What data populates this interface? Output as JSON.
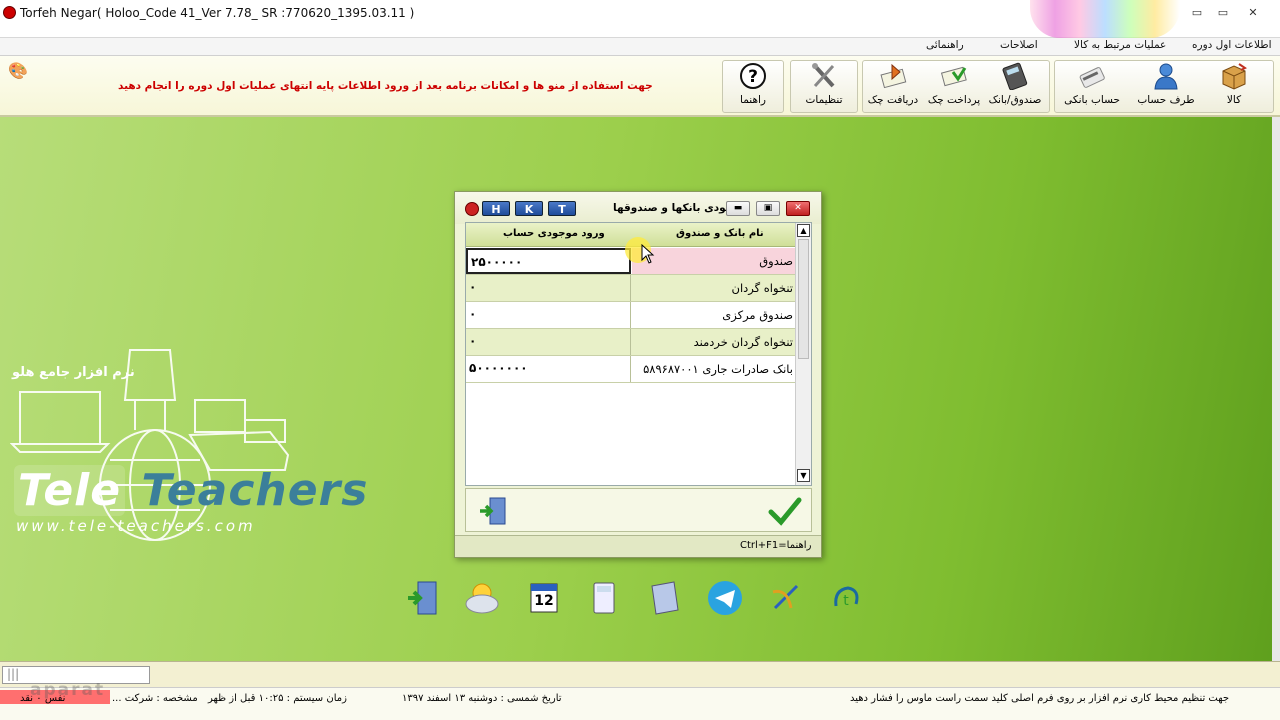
{
  "window": {
    "title": "Torfeh Negar( Holoo_Code 41_Ver 7.78_ SR :770620_1395.03.11 )",
    "controls": [
      "▭",
      "▭",
      "✕"
    ]
  },
  "menubar": {
    "items": [
      "اطلاعات اول دوره",
      "عملیات مرتبط به کالا",
      "اصلاحات",
      "راهنمائی"
    ]
  },
  "toolbar": {
    "notice": "جهت استفاده از منو ها و امکانات برنامه بعد از ورود اطلاعات پایه انتهای عملیات اول دوره را انجام دهید",
    "buttons": [
      "کالا",
      "طرف حساب",
      "حساب بانکی",
      "صندوق/بانک",
      "پرداخت چک",
      "دریافت چک",
      "تنظیمات",
      "راهنما"
    ],
    "icons": [
      "box-icon",
      "person-icon",
      "bank-card-icon",
      "calculator-icon",
      "pay-check-icon",
      "receive-check-icon",
      "tools-icon",
      "help-icon"
    ]
  },
  "desktop": {
    "brand_text": "نرم افزار جامع هلو",
    "tele_part1": "Tele",
    "tele_part2": "Teachers",
    "tele_url": "www.tele-teachers.com",
    "dock_icons": [
      "exit-door-icon",
      "weather-icon",
      "calendar-icon",
      "calculator-icon",
      "notes-icon",
      "telegram-icon",
      "satellite-icon",
      "logo-icon"
    ],
    "calendar_day": "12"
  },
  "dialog": {
    "title": "موجودی بانکها و صندوقها",
    "hkt_buttons": [
      "H",
      "K",
      "T"
    ],
    "columns": [
      "نام بانک و صندوق",
      "ورود موجودی حساب"
    ],
    "rows": [
      {
        "name": "صندوق",
        "amount": "۲۵۰۰۰۰۰"
      },
      {
        "name": "تنخواه گردان",
        "amount": "۰"
      },
      {
        "name": "صندوق مرکزی",
        "amount": "۰"
      },
      {
        "name": "تنخواه گردان خردمند",
        "amount": "۰"
      },
      {
        "name": "بانک صادرات جاری ۵۸۹۶۸۷۰۰۱",
        "amount": "۵۰۰۰۰۰۰۰"
      }
    ],
    "help_hint": "راهنما=Ctrl+F1"
  },
  "bottombar": {
    "progress_text": "|||"
  },
  "statusbar": {
    "hint": "جهت تنظیم محیط کاری نرم افزار بر روی فرم اصلی کلید سمت راست ماوس را فشار دهید",
    "date": "تاریخ شمسی : دوشنبه ۱۳ اسفند ۱۳۹۷",
    "time": "زمان سیستم : ۱۰:۲۵ قبل از ظهر",
    "company": "مشخصه : شرکت ...",
    "user": "نفس ۰ نقد"
  },
  "watermark": "aparat"
}
